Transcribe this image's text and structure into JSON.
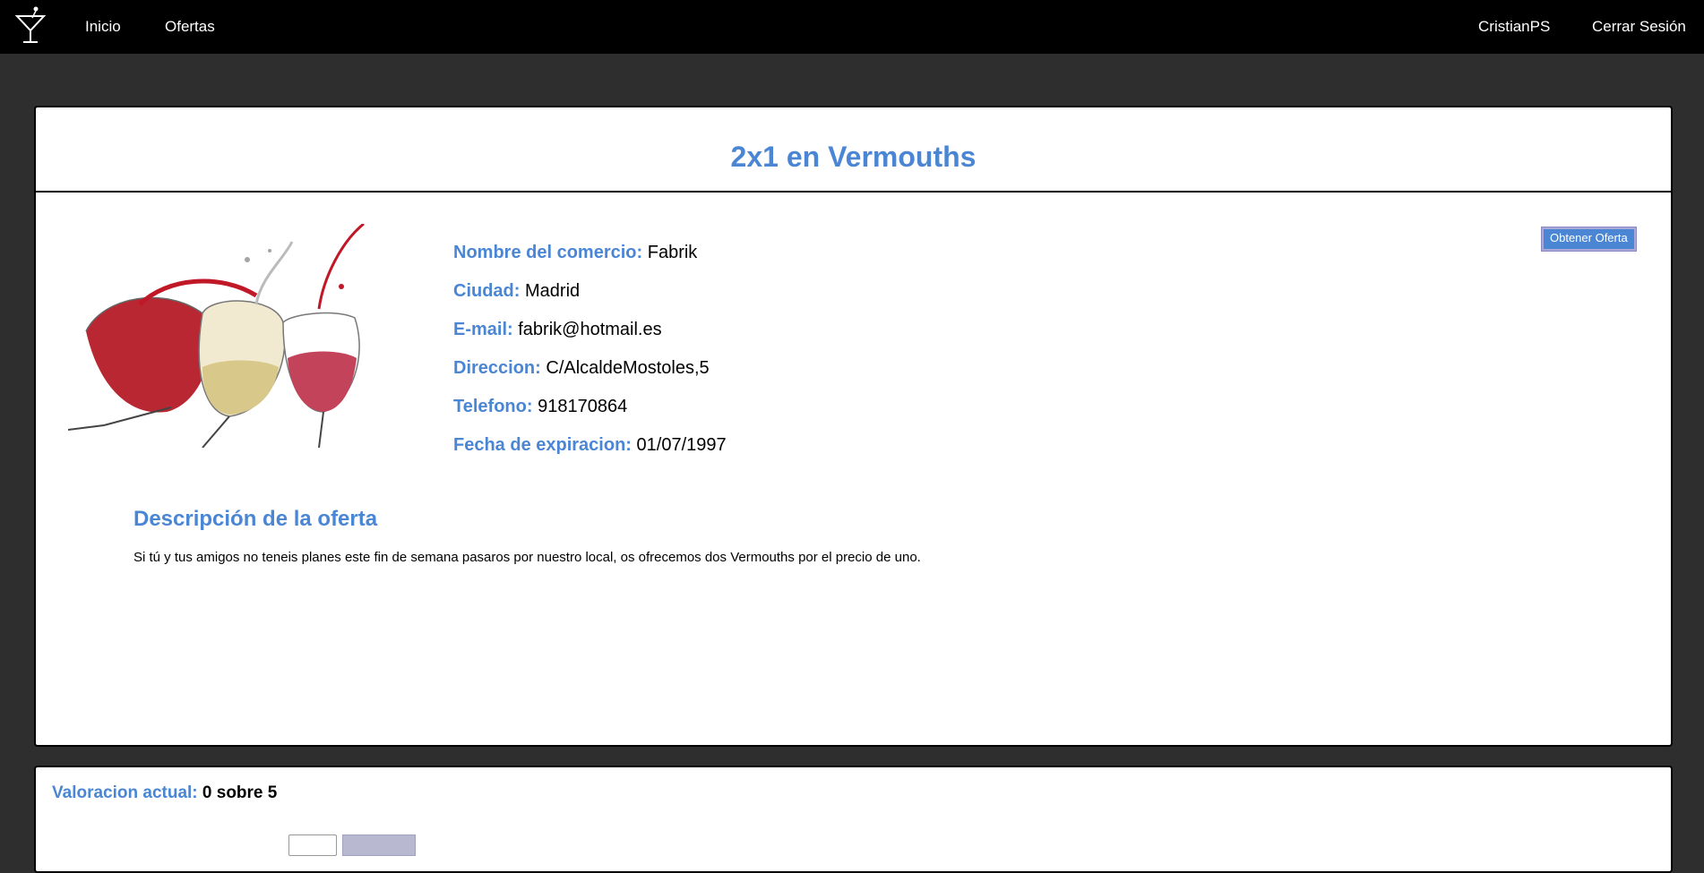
{
  "nav": {
    "logo_icon": "cocktail-glass-icon",
    "home_label": "Inicio",
    "offers_label": "Ofertas",
    "user_label": "CristianPS",
    "logout_label": "Cerrar Sesión"
  },
  "offer": {
    "title": "2x1 en Vermouths",
    "image_icon": "wine-glasses-image",
    "obtain_button": "Obtener Oferta",
    "fields": [
      {
        "label": "Nombre del comercio:",
        "value": "Fabrik"
      },
      {
        "label": "Ciudad:",
        "value": "Madrid"
      },
      {
        "label": "E-mail:",
        "value": "fabrik@hotmail.es"
      },
      {
        "label": "Direccion:",
        "value": "C/AlcaldeMostoles,5"
      },
      {
        "label": "Telefono:",
        "value": "918170864"
      },
      {
        "label": "Fecha de expiracion:",
        "value": "01/07/1997"
      }
    ],
    "description_title": "Descripción de la oferta",
    "description_text": "Si tú y tus amigos no teneis planes este fin de semana pasaros por nuestro local, os ofrecemos dos Vermouths por el precio de uno."
  },
  "rating": {
    "label": "Valoracion actual:",
    "value": "0 sobre 5"
  },
  "colors": {
    "accent": "#4a86d4",
    "nav_bg": "#000000",
    "page_bg": "#2e2e2e"
  }
}
